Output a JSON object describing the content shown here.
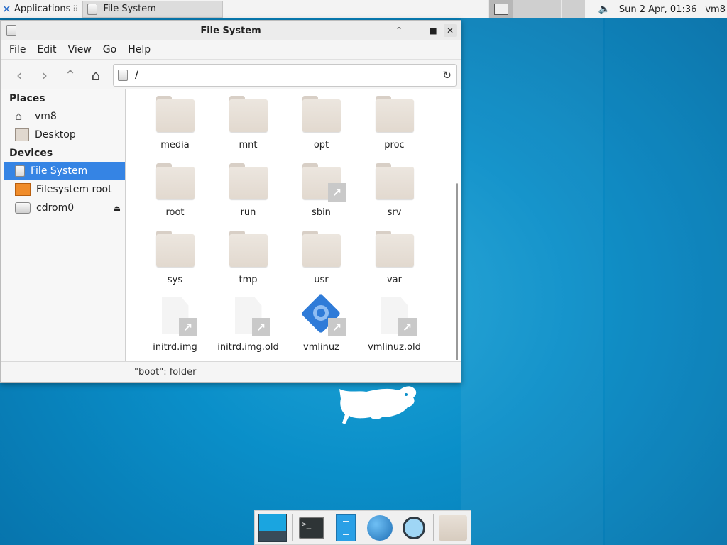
{
  "top_panel": {
    "applications_label": "Applications",
    "applications_suffix": "⠿",
    "task_title": "File System",
    "clock": "Sun  2 Apr, 01:36",
    "user": "vm8"
  },
  "window": {
    "title": "File System",
    "controls": {
      "shade": "⌃",
      "minimize": "—",
      "maximize": "■",
      "close": "✕"
    },
    "menu": [
      "File",
      "Edit",
      "View",
      "Go",
      "Help"
    ],
    "location": "/",
    "icons": {
      "back": "back-icon",
      "forward": "forward-icon",
      "up": "up-icon",
      "home": "home-icon",
      "reload": "reload-icon"
    }
  },
  "sidebar": {
    "places_header": "Places",
    "places": [
      "vm8",
      "Desktop"
    ],
    "devices_header": "Devices",
    "devices": [
      "File System",
      "Filesystem root",
      "cdrom0"
    ]
  },
  "files": [
    {
      "name": "media",
      "kind": "folder"
    },
    {
      "name": "mnt",
      "kind": "folder"
    },
    {
      "name": "opt",
      "kind": "folder"
    },
    {
      "name": "proc",
      "kind": "folder"
    },
    {
      "name": "root",
      "kind": "folder"
    },
    {
      "name": "run",
      "kind": "folder"
    },
    {
      "name": "sbin",
      "kind": "folder-link"
    },
    {
      "name": "srv",
      "kind": "folder"
    },
    {
      "name": "sys",
      "kind": "folder"
    },
    {
      "name": "tmp",
      "kind": "folder"
    },
    {
      "name": "usr",
      "kind": "folder"
    },
    {
      "name": "var",
      "kind": "folder"
    },
    {
      "name": "initrd.img",
      "kind": "file-link"
    },
    {
      "name": "initrd.img.old",
      "kind": "file-link"
    },
    {
      "name": "vmlinuz",
      "kind": "exec-link"
    },
    {
      "name": "vmlinuz.old",
      "kind": "file-link"
    }
  ],
  "status": "\"boot\": folder",
  "colors": {
    "selection": "#3584e4",
    "desktop": "#0a8fc9",
    "folder": "#e6ddd4"
  },
  "dock": [
    "show-desktop",
    "terminal",
    "file-manager",
    "web-browser",
    "app-finder",
    "home-folder"
  ]
}
